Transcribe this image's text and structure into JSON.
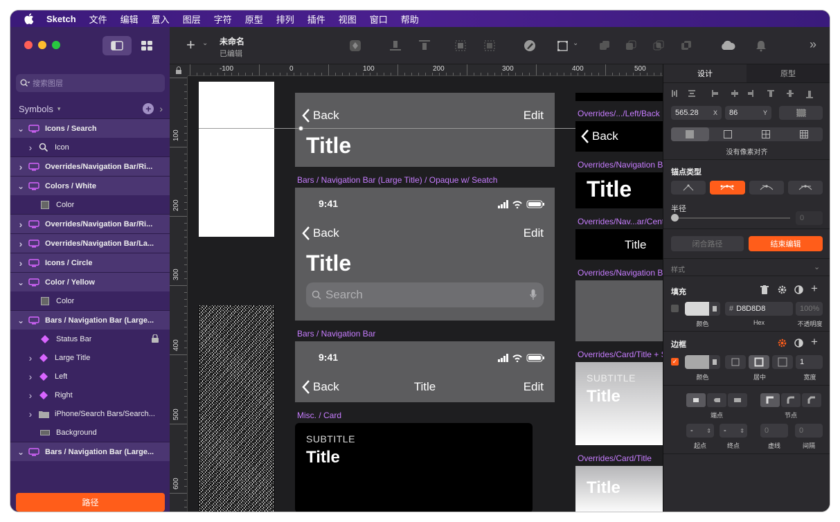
{
  "menubar": {
    "app_name": "Sketch",
    "items": [
      "文件",
      "编辑",
      "置入",
      "图层",
      "字符",
      "原型",
      "排列",
      "插件",
      "视图",
      "窗口",
      "帮助"
    ]
  },
  "sidebar": {
    "search_placeholder": "搜索图层",
    "symbols_label": "Symbols",
    "layers": [
      {
        "label": "Icons / Search",
        "kind": "group",
        "expanded": true
      },
      {
        "label": "Icon",
        "kind": "child",
        "icon": "search-icon"
      },
      {
        "label": "Overrides/Navigation Bar/Ri...",
        "kind": "group",
        "expanded": false
      },
      {
        "label": "Colors / White",
        "kind": "group",
        "expanded": true
      },
      {
        "label": "Color",
        "kind": "child2",
        "icon": "square-icon"
      },
      {
        "label": "Overrides/Navigation Bar/Ri...",
        "kind": "group",
        "expanded": false
      },
      {
        "label": "Overrides/Navigation Bar/La...",
        "kind": "group",
        "expanded": false
      },
      {
        "label": "Icons / Circle",
        "kind": "group",
        "expanded": false
      },
      {
        "label": "Color / Yellow",
        "kind": "group",
        "expanded": true
      },
      {
        "label": "Color",
        "kind": "child2",
        "icon": "square-icon"
      },
      {
        "label": "Bars / Navigation Bar (Large...",
        "kind": "group",
        "expanded": true
      },
      {
        "label": "Status Bar",
        "kind": "child2",
        "icon": "symbol-diamond-icon",
        "locked": true
      },
      {
        "label": "Large Title",
        "kind": "child",
        "icon": "symbol-diamond-icon"
      },
      {
        "label": "Left",
        "kind": "child",
        "icon": "symbol-diamond-icon"
      },
      {
        "label": "Right",
        "kind": "child",
        "icon": "symbol-diamond-icon"
      },
      {
        "label": "iPhone/Search Bars/Search...",
        "kind": "child",
        "icon": "folder-icon"
      },
      {
        "label": "Background",
        "kind": "child2",
        "icon": "rectangle-icon"
      },
      {
        "label": "Bars / Navigation Bar (Large...",
        "kind": "group",
        "expanded": true
      }
    ],
    "path_button": "路径"
  },
  "toolbar": {
    "doc_title": "未命名",
    "doc_status": "已编辑"
  },
  "ruler": {
    "h_ticks": [
      "-100",
      "0",
      "100",
      "200",
      "300",
      "400",
      "500"
    ],
    "v_ticks": [
      "100",
      "200",
      "300",
      "400",
      "500",
      "600"
    ]
  },
  "canvas": {
    "back": "Back",
    "edit": "Edit",
    "title": "Title",
    "time": "9:41",
    "search": "Search",
    "subtitle": "SUBTITLE",
    "labels": {
      "opaque_search": "Bars / Navigation Bar (Large Title) / Opaque w/ Seatch",
      "nav_bar": "Bars / Navigation Bar",
      "misc_card": "Misc. / Card",
      "ov_left_back": "Overrides/.../Left/Back",
      "ov_nav_bar": "Overrides/Navigation Bar",
      "ov_center": "Overrides/Nav...ar/Cente",
      "ov_nav_bar2": "Overrides/Navigation Bar",
      "ov_card_title_sub": "Overrides/Card/Title + Su",
      "ov_card_title": "Overrides/Card/Title"
    }
  },
  "inspector": {
    "tab_design": "设计",
    "tab_prototype": "原型",
    "x_value": "565.28",
    "x_label": "X",
    "y_value": "86",
    "y_label": "Y",
    "pixel_align": "没有像素对齐",
    "anchor_type": "锚点类型",
    "radius": "半径",
    "radius_value": "0",
    "close_path": "闭合路径",
    "finish_edit": "结束编辑",
    "style": "样式",
    "fill": "填充",
    "fill_hex": "D8D8D8",
    "fill_hex_prefix": "#",
    "fill_opacity": "100",
    "fill_opacity_unit": "%",
    "label_color": "颜色",
    "label_hex": "Hex",
    "label_opacity": "不透明度",
    "border": "边框",
    "border_width": "1",
    "label_center": "居中",
    "label_width": "宽度",
    "label_cap": "端点",
    "label_join": "节点",
    "start_value": "-",
    "end_value": "-",
    "dash_value": "0",
    "gap_value": "0",
    "label_start": "起点",
    "label_end": "终点",
    "label_dash": "虚线",
    "label_gap": "间隔",
    "colors": {
      "accent": "#ff5d1a",
      "fill_swatch": "#d8d8d8",
      "border_swatch": "#a8a8a8"
    }
  }
}
